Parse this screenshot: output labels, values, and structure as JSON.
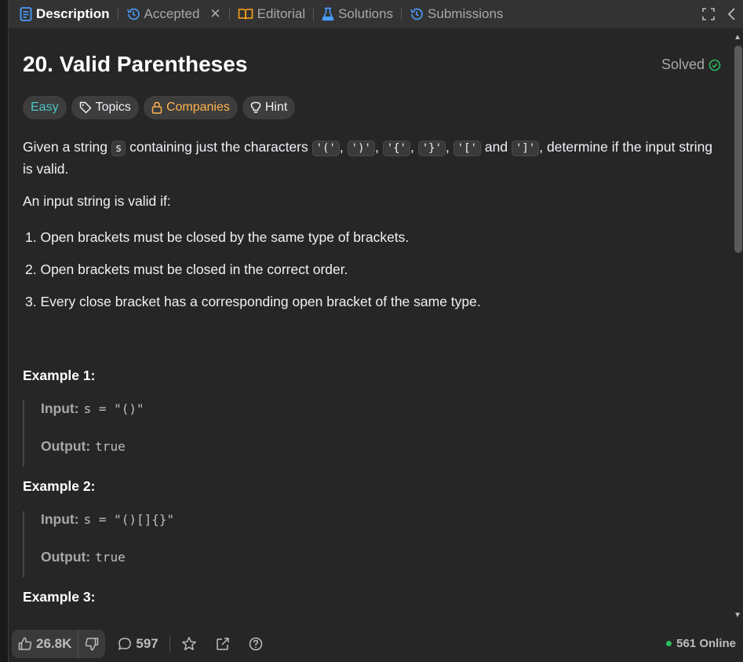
{
  "tabs": [
    {
      "label": "Description",
      "icon": "document-icon"
    },
    {
      "label": "Accepted",
      "icon": "history-icon"
    },
    {
      "label": "Editorial",
      "icon": "book-icon"
    },
    {
      "label": "Solutions",
      "icon": "flask-icon"
    },
    {
      "label": "Submissions",
      "icon": "history-icon"
    }
  ],
  "problem": {
    "title": "20. Valid Parentheses",
    "status": "Solved",
    "tags": {
      "difficulty": "Easy",
      "topics": "Topics",
      "companies": "Companies",
      "hint": "Hint"
    },
    "intro": {
      "a": "Given a string ",
      "code_s": "s",
      "b": " containing just the characters ",
      "c1": "'('",
      "c2": "')'",
      "c3": "'{'",
      "c4": "'}'",
      "c5": "'['",
      "c6": "']'",
      "and": "and",
      "d": ", determine if the input string is valid."
    },
    "valid_if": "An input string is valid if:",
    "rules": [
      "1. Open brackets must be closed by the same type of brackets.",
      "2. Open brackets must be closed in the correct order.",
      "3. Every close bracket has a corresponding open bracket of the same type."
    ],
    "examples": [
      {
        "heading": "Example 1:",
        "input_label": "Input:",
        "input": "s = \"()\"",
        "output_label": "Output:",
        "output": "true"
      },
      {
        "heading": "Example 2:",
        "input_label": "Input:",
        "input": "s = \"()[]{}\"",
        "output_label": "Output:",
        "output": "true"
      },
      {
        "heading": "Example 3:"
      }
    ]
  },
  "footer": {
    "likes": "26.8K",
    "comments": "597",
    "online": "561 Online"
  },
  "colors": {
    "accent_blue": "#4a9eff",
    "easy": "#46c6c2",
    "companies": "#ffb44c",
    "solved": "#2cbb5d"
  }
}
